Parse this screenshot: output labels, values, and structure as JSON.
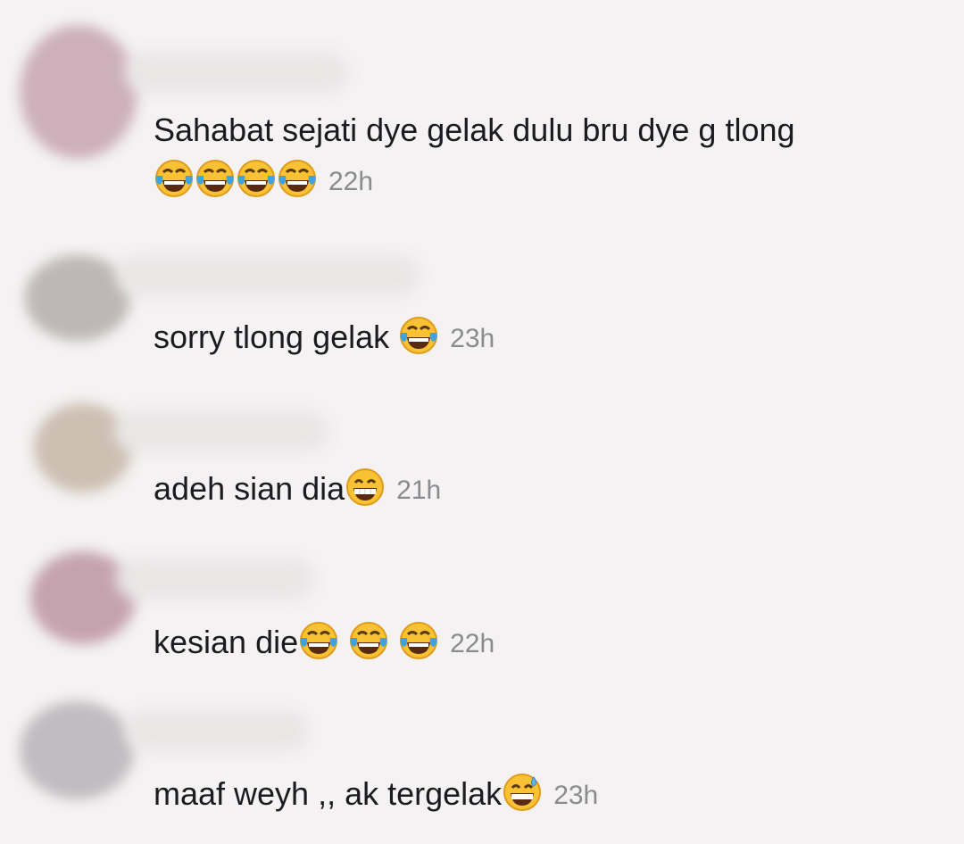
{
  "comments": [
    {
      "text": "Sahabat sejati dye gelak dulu bru dye g tlong",
      "emojis": [
        "face-with-tears-of-joy-icon",
        "face-with-tears-of-joy-icon",
        "face-with-tears-of-joy-icon",
        "face-with-tears-of-joy-icon"
      ],
      "time": "22h",
      "avatar_color": "#c9a9b3"
    },
    {
      "text": "sorry tlong gelak ",
      "emojis": [
        "face-with-tears-of-joy-icon"
      ],
      "time": "23h",
      "avatar_color": "#b9b3b2"
    },
    {
      "text": "adeh sian dia",
      "emojis": [
        "grinning-face-with-smiling-eyes-icon"
      ],
      "time": "21h",
      "avatar_color": "#cbbdb0"
    },
    {
      "text": "kesian die",
      "emojis": [
        "face-with-tears-of-joy-icon",
        "face-with-tears-of-joy-icon",
        "face-with-tears-of-joy-icon"
      ],
      "time": "22h",
      "avatar_color": "#c2a2ad"
    },
    {
      "text": "maaf weyh ,, ak tergelak",
      "emojis": [
        "grinning-face-with-sweat-icon"
      ],
      "time": "23h",
      "avatar_color": "#bfbbbf"
    }
  ],
  "colors": {
    "background": "#f4f2f2",
    "text": "#1c1b20",
    "timestamp": "#8b8b8f"
  }
}
